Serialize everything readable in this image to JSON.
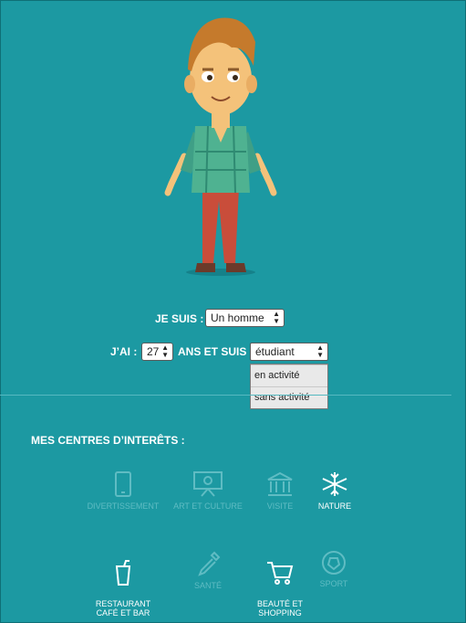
{
  "profile": {
    "gender_label": "JE SUIS :",
    "gender_value": "Un homme",
    "age_label": "J’AI :",
    "age_value": "27",
    "status_label": "ANS ET SUIS",
    "status_value": "étudiant",
    "status_options": [
      "en activité",
      "sans activité"
    ]
  },
  "interests": {
    "title": "MES CENTRES D’INTERÊTS :",
    "items": [
      {
        "label": "DIVERTISSEMENT",
        "icon": "smartphone-icon",
        "selected": false
      },
      {
        "label": "ART ET CULTURE",
        "icon": "projector-icon",
        "selected": false
      },
      {
        "label": "VISITE",
        "icon": "monument-icon",
        "selected": false
      },
      {
        "label": "NATURE",
        "icon": "snowflake-icon",
        "selected": true
      },
      {
        "label": "RESTAURANT\nCAFÉ ET BAR",
        "icon": "drink-icon",
        "selected": true
      },
      {
        "label": "SANTÉ",
        "icon": "dropper-icon",
        "selected": false
      },
      {
        "label": "BEAUTÉ ET\nSHOPPING",
        "icon": "cart-icon",
        "selected": true
      },
      {
        "label": "SPORT",
        "icon": "ball-icon",
        "selected": false
      }
    ]
  },
  "colors": {
    "background": "#1c99a2",
    "inactive": "#5fbcc3",
    "active": "#ffffff"
  }
}
